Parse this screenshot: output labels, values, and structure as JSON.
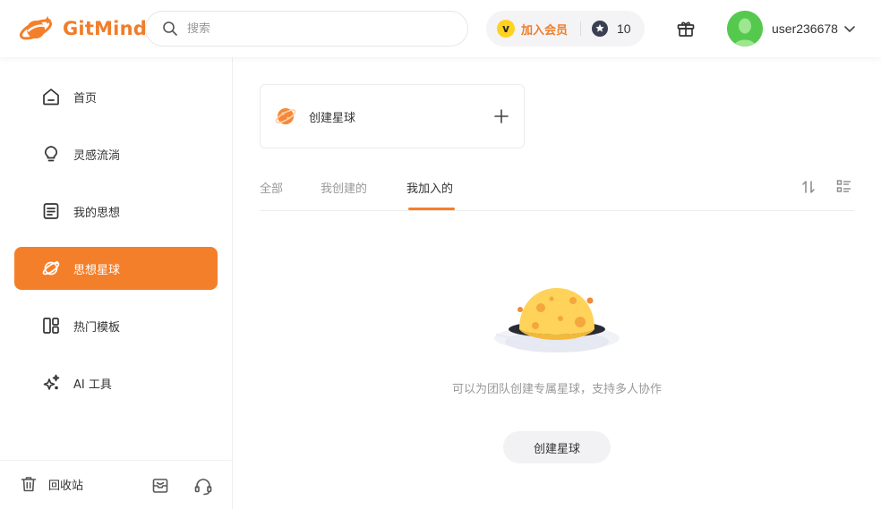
{
  "app": {
    "logo_text": "GitMind",
    "brand_color": "#f47f2a"
  },
  "header": {
    "search_placeholder": "搜索",
    "vip_badge_letter": "v",
    "vip_label": "加入会员",
    "coin_count": "10",
    "username": "user236678"
  },
  "sidebar": {
    "items": [
      {
        "label": "首页",
        "icon": "home-icon"
      },
      {
        "label": "灵感流淌",
        "icon": "lightbulb-icon"
      },
      {
        "label": "我的思想",
        "icon": "document-icon"
      },
      {
        "label": "思想星球",
        "icon": "planet-icon",
        "active": true
      },
      {
        "label": "热门模板",
        "icon": "template-icon"
      },
      {
        "label": "AI 工具",
        "icon": "sparkle-icon"
      }
    ],
    "bottom": {
      "trash_label": "回收站"
    }
  },
  "main": {
    "create_card_label": "创建星球",
    "tabs": [
      {
        "label": "全部"
      },
      {
        "label": "我创建的"
      },
      {
        "label": "我加入的",
        "active": true
      }
    ],
    "empty_text": "可以为团队创建专属星球，支持多人协作",
    "empty_button": "创建星球"
  }
}
